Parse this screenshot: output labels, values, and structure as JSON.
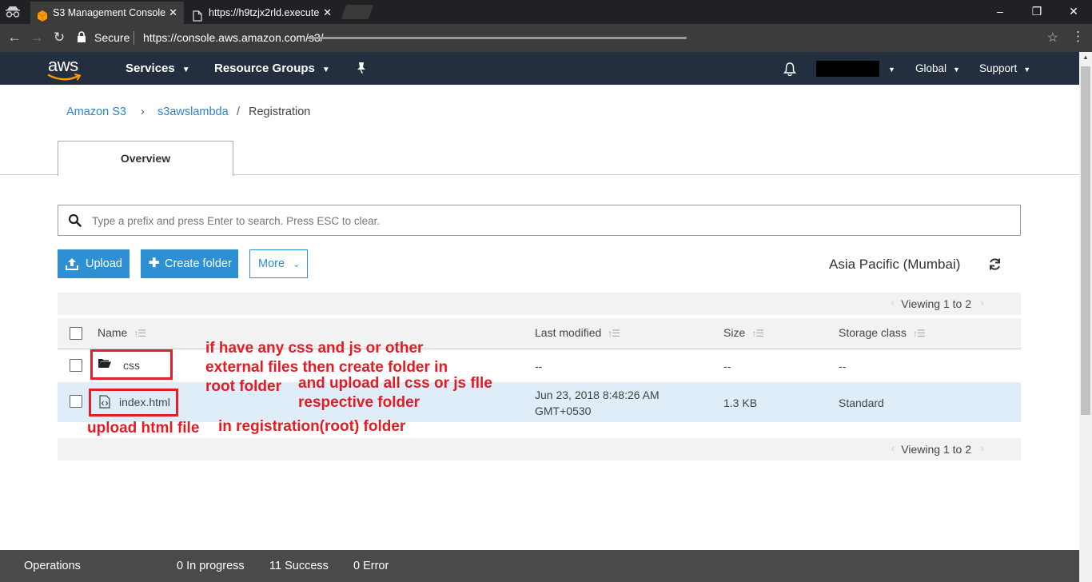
{
  "browser": {
    "tabs": [
      {
        "title": "S3 Management Console",
        "active": true
      },
      {
        "title": "https://h9tzjx2rld.execute",
        "active": false
      }
    ],
    "secure_label": "Secure",
    "url_visible": "https://console.aws.amazon.com/s3/",
    "window_controls": {
      "minimize": "–",
      "maximize": "❐",
      "close": "✕"
    }
  },
  "aws_header": {
    "logo_text": "aws",
    "services_label": "Services",
    "resource_groups_label": "Resource Groups",
    "global_label": "Global",
    "support_label": "Support",
    "colors": {
      "bar": "#232f3e",
      "accent": "#ff9900"
    }
  },
  "breadcrumb": {
    "root": "Amazon S3",
    "separator1": "›",
    "bucket": "s3awslambda",
    "separator2": "/",
    "folder": "Registration"
  },
  "tabs": {
    "overview": "Overview"
  },
  "search": {
    "placeholder": "Type a prefix and press Enter to search. Press ESC to clear."
  },
  "actions": {
    "upload": "Upload",
    "create_folder": "Create folder",
    "more": "More",
    "region": "Asia Pacific (Mumbai)"
  },
  "viewing": {
    "label": "Viewing 1 to 2"
  },
  "table": {
    "columns": {
      "name": "Name",
      "last_modified": "Last modified",
      "size": "Size",
      "storage_class": "Storage class"
    },
    "rows": [
      {
        "name": "css",
        "type": "folder",
        "last_modified": "--",
        "size": "--",
        "storage_class": "--"
      },
      {
        "name": "index.html",
        "type": "file",
        "last_modified_line1": "Jun 23, 2018 8:48:26 AM",
        "last_modified_line2": "GMT+0530",
        "size": "1.3 KB",
        "storage_class": "Standard"
      }
    ]
  },
  "annotations": {
    "a1": "if have any css and js or other",
    "a2": "external files then create folder in",
    "a3": "root folder",
    "a4": "and upload all css or js flle",
    "a5": "respective folder",
    "a6": "upload html file",
    "a7": "in registration(root) folder"
  },
  "footer": {
    "operations": "Operations",
    "in_progress": "0 In progress",
    "success": "11 Success",
    "error": "0 Error"
  }
}
